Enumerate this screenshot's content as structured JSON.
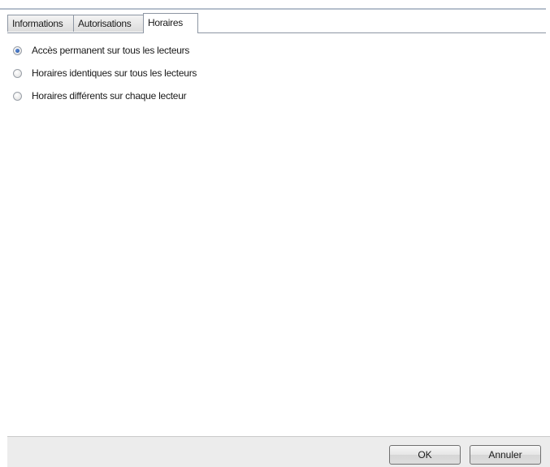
{
  "tabs": [
    {
      "label": "Informations",
      "active": false
    },
    {
      "label": "Autorisations",
      "active": false
    },
    {
      "label": "Horaires",
      "active": true
    }
  ],
  "options": [
    {
      "label": "Accès permanent sur tous les lecteurs",
      "checked": true
    },
    {
      "label": "Horaires identiques sur tous les lecteurs",
      "checked": false
    },
    {
      "label": "Horaires différents sur chaque lecteur",
      "checked": false
    }
  ],
  "buttons": {
    "ok_label": "OK",
    "cancel_label": "Annuler"
  },
  "colors": {
    "tab_border": "#8d96a3",
    "radio_selected": "#1f4f9e",
    "bottom_bar": "#ececec"
  }
}
